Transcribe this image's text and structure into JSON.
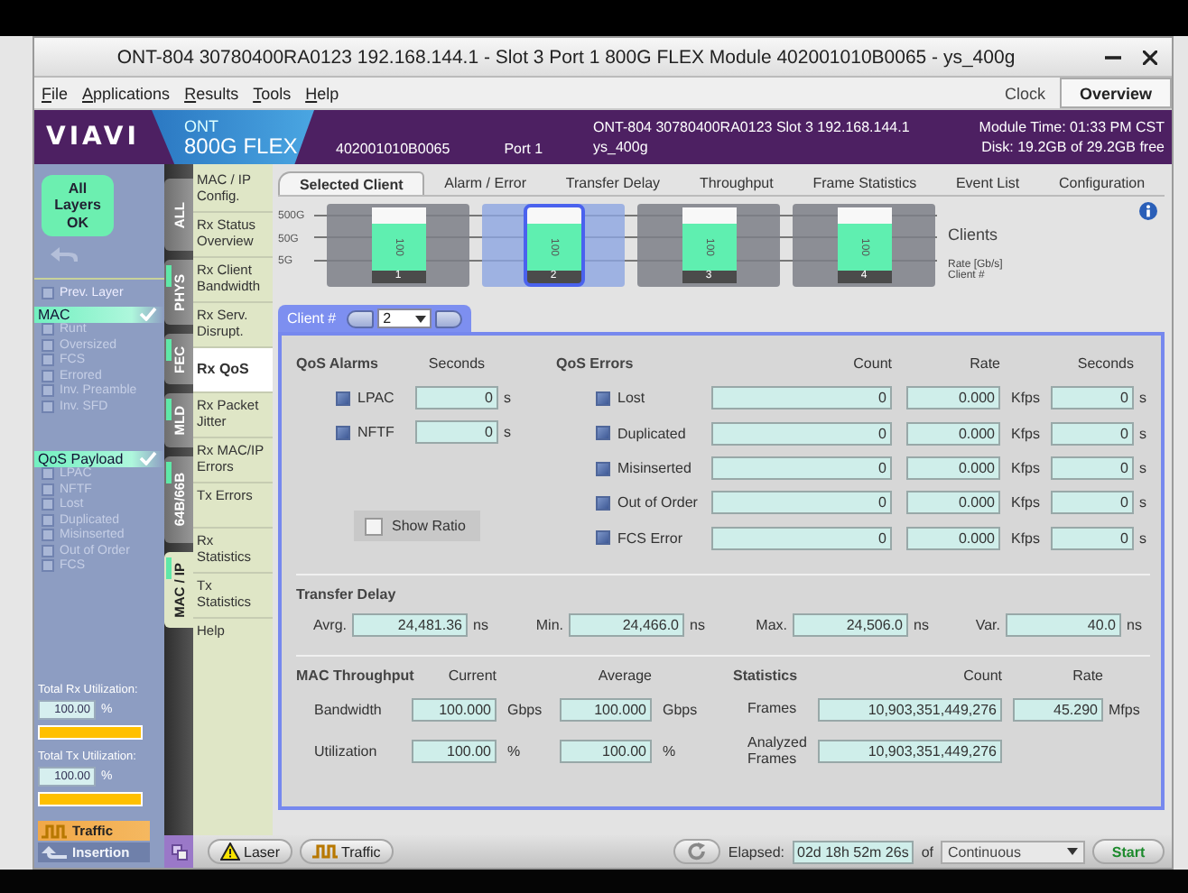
{
  "window": {
    "title": "ONT-804 30780400RA0123 192.168.144.1 - Slot 3 Port 1 800G FLEX Module 402001010B0065 - ys_400g"
  },
  "menu": [
    "File",
    "Applications",
    "Results",
    "Tools",
    "Help"
  ],
  "clock": "Clock",
  "overview": "Overview",
  "header": {
    "logo": "VIAVI",
    "product_line": "ONT",
    "product": "800G FLEX",
    "module": "402001010B0065",
    "port": "Port 1",
    "device": "ONT-804 30780400RA0123 Slot 3 192.168.144.1",
    "profile": "ys_400g",
    "module_time": "Module Time: 01:33 PM CST",
    "disk": "Disk: 19.2GB of 29.2GB free"
  },
  "status": "All Layers OK",
  "prev_layer": {
    "label": "Prev. Layer",
    "checked": false
  },
  "layer_groups": [
    {
      "name": "MAC",
      "ok": true,
      "items": [
        {
          "label": "Runt",
          "checked": false
        },
        {
          "label": "Oversized",
          "checked": false
        },
        {
          "label": "FCS",
          "checked": false
        },
        {
          "label": "Errored",
          "checked": false
        },
        {
          "label": "Inv. Preamble",
          "checked": false
        },
        {
          "label": "Inv. SFD",
          "checked": false
        }
      ]
    },
    {
      "name": "QoS Payload",
      "ok": true,
      "items": [
        {
          "label": "LPAC",
          "checked": false
        },
        {
          "label": "NFTF",
          "checked": false
        },
        {
          "label": "Lost",
          "checked": false
        },
        {
          "label": "Duplicated",
          "checked": false
        },
        {
          "label": "Misinserted",
          "checked": false
        },
        {
          "label": "Out of Order",
          "checked": false
        },
        {
          "label": "FCS",
          "checked": false
        }
      ]
    }
  ],
  "utilization": [
    {
      "label": "Total Rx Utilization:",
      "value": "100.00",
      "unit": "%",
      "level": 1
    },
    {
      "label": "Total Tx Utilization:",
      "value": "100.00",
      "unit": "%",
      "level": 1
    }
  ],
  "modes": [
    {
      "label": "Traffic",
      "kind": "wave",
      "selected": true
    },
    {
      "label": "Insertion",
      "kind": "arrow",
      "selected": false
    }
  ],
  "layer_tabs": [
    {
      "label": "ALL",
      "indicator": false,
      "selected": false
    },
    {
      "label": "PHYS",
      "indicator": true,
      "selected": false
    },
    {
      "label": "FEC",
      "indicator": true,
      "selected": false
    },
    {
      "label": "MLD",
      "indicator": true,
      "selected": false
    },
    {
      "label": "64B/66B",
      "indicator": true,
      "selected": false
    },
    {
      "label": "MAC / IP",
      "indicator": true,
      "selected": true
    }
  ],
  "views": [
    {
      "label": "MAC / IP Config.",
      "selected": false
    },
    {
      "label": "Rx Status Overview",
      "selected": false
    },
    {
      "label": "Rx Client Bandwidth",
      "selected": false
    },
    {
      "label": "Rx Serv. Disrupt.",
      "selected": false
    },
    {
      "label": "Rx QoS",
      "selected": true
    },
    {
      "label": "Rx Packet Jitter",
      "selected": false
    },
    {
      "label": "Rx MAC/IP Errors",
      "selected": false
    },
    {
      "label": "Tx Errors",
      "selected": false
    },
    {
      "label": "Rx Statistics",
      "selected": false
    },
    {
      "label": "Tx Statistics",
      "selected": false
    },
    {
      "label": "Help",
      "selected": false
    }
  ],
  "tabs": [
    {
      "label": "Selected Client",
      "selected": true
    },
    {
      "label": "Alarm / Error",
      "selected": false
    },
    {
      "label": "Transfer Delay",
      "selected": false
    },
    {
      "label": "Throughput",
      "selected": false
    },
    {
      "label": "Frame Statistics",
      "selected": false
    },
    {
      "label": "Event List",
      "selected": false
    },
    {
      "label": "Configuration",
      "selected": false
    }
  ],
  "chart": {
    "axis": [
      "500G",
      "50G",
      "5G"
    ],
    "legend": "Clients",
    "rate_label": "Rate [Gb/s]",
    "client_label": "Client #"
  },
  "clients": [
    {
      "number": "1",
      "rate": "100",
      "level": 0.75,
      "selected": false
    },
    {
      "number": "2",
      "rate": "100",
      "level": 0.75,
      "selected": true
    },
    {
      "number": "3",
      "rate": "100",
      "level": 0.75,
      "selected": false
    },
    {
      "number": "4",
      "rate": "100",
      "level": 0.75,
      "selected": false
    }
  ],
  "client_selector": {
    "label": "Client #",
    "value": "2"
  },
  "qos_alarms": {
    "title": "QoS Alarms",
    "header": "Seconds",
    "rows": [
      {
        "label": "LPAC",
        "value": "0",
        "unit": "s"
      },
      {
        "label": "NFTF",
        "value": "0",
        "unit": "s"
      }
    ]
  },
  "show_ratio": {
    "label": "Show Ratio",
    "checked": false
  },
  "qos_errors": {
    "title": "QoS Errors",
    "headers": [
      "Count",
      "Rate",
      "Seconds"
    ],
    "rows": [
      {
        "label": "Lost",
        "count": "0",
        "rate": "0.000",
        "rate_unit": "Kfps",
        "seconds": "0",
        "seconds_unit": "s"
      },
      {
        "label": "Duplicated",
        "count": "0",
        "rate": "0.000",
        "rate_unit": "Kfps",
        "seconds": "0",
        "seconds_unit": "s"
      },
      {
        "label": "Misinserted",
        "count": "0",
        "rate": "0.000",
        "rate_unit": "Kfps",
        "seconds": "0",
        "seconds_unit": "s"
      },
      {
        "label": "Out of Order",
        "count": "0",
        "rate": "0.000",
        "rate_unit": "Kfps",
        "seconds": "0",
        "seconds_unit": "s"
      },
      {
        "label": "FCS Error",
        "count": "0",
        "rate": "0.000",
        "rate_unit": "Kfps",
        "seconds": "0",
        "seconds_unit": "s"
      }
    ]
  },
  "transfer_delay": {
    "title": "Transfer Delay",
    "fields": [
      {
        "label": "Avrg.",
        "value": "24,481.36",
        "unit": "ns"
      },
      {
        "label": "Min.",
        "value": "24,466.0",
        "unit": "ns"
      },
      {
        "label": "Max.",
        "value": "24,506.0",
        "unit": "ns"
      },
      {
        "label": "Var.",
        "value": "40.0",
        "unit": "ns"
      }
    ]
  },
  "mac_throughput": {
    "title": "MAC Throughput",
    "headers": [
      "Current",
      "Average"
    ],
    "rows": [
      {
        "label": "Bandwidth",
        "current": "100.000",
        "current_unit": "Gbps",
        "average": "100.000",
        "average_unit": "Gbps"
      },
      {
        "label": "Utilization",
        "current": "100.00",
        "current_unit": "%",
        "average": "100.00",
        "average_unit": "%"
      }
    ]
  },
  "statistics": {
    "title": "Statistics",
    "headers": [
      "Count",
      "Rate"
    ],
    "rows": [
      {
        "label": "Frames",
        "count": "10,903,351,449,276",
        "rate": "45.290",
        "rate_unit": "Mfps"
      },
      {
        "label": "Analyzed Frames",
        "count": "10,903,351,449,276"
      }
    ]
  },
  "toolbar": {
    "laser": "Laser",
    "traffic": "Traffic",
    "elapsed_label": "Elapsed:",
    "elapsed": "02d 18h 52m 26s",
    "of": "of",
    "duration": "Continuous",
    "start": "Start"
  }
}
